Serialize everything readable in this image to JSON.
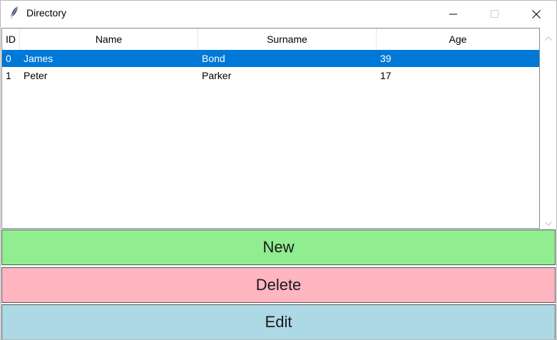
{
  "window": {
    "title": "Directory",
    "icon": "feather-icon",
    "controls": [
      "minimize-icon",
      "maximize-icon",
      "close-icon"
    ]
  },
  "table": {
    "columns": [
      "ID",
      "Name",
      "Surname",
      "Age"
    ],
    "rows": [
      {
        "id": "0",
        "name": "James",
        "surname": "Bond",
        "age": "39",
        "selected": true
      },
      {
        "id": "1",
        "name": "Peter",
        "surname": "Parker",
        "age": "17",
        "selected": false
      }
    ],
    "selection_color": "#0078d7"
  },
  "buttons": {
    "new": {
      "label": "New",
      "color": "#90ee90"
    },
    "delete": {
      "label": "Delete",
      "color": "#ffb6c1"
    },
    "edit": {
      "label": "Edit",
      "color": "#add8e6"
    }
  }
}
